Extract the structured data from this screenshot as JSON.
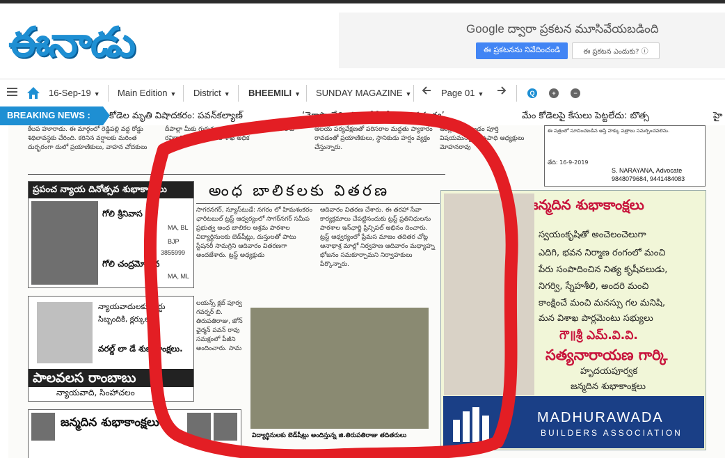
{
  "brand": {
    "logo_text": "ఈనాడు",
    "logo_color": "#1e8fd3"
  },
  "ad": {
    "by_google": "Google ద్వారా ప్రకటన మూసివేయబడింది",
    "report_button": "ఈ ప్రకటనను నివేదించండి",
    "why_button": "ఈ ప్రకటన ఎందుకు?",
    "info_icon": "ⓘ"
  },
  "nav": {
    "menu_icon": "hamburger-icon",
    "home_icon": "home-icon",
    "date": "16-Sep-19",
    "edition": "Main Edition",
    "district": "District",
    "area": "BHEEMILI",
    "magazine": "SUNDAY MAGAZINE",
    "page": "Page 01",
    "zoom_reset": "Q",
    "zoom_in": "+",
    "zoom_out": "−",
    "accent": "#1e8fd3"
  },
  "breaking": {
    "label": "BREAKING NEWS :",
    "items": [
      "కోడెల మృతి విషాదకరం: పవన్‌కల్యాణ్",
      "‘వైకాపా వేధింపులతోనే కోడెల ఆత్మహత్య’",
      "మేం కోడెలపై కేసులు పెట్టలేదు: బొత్స",
      "హై"
    ]
  },
  "paper": {
    "top_left_text": "కేలప హూరాడు. ఈ మార్గంలో రెడ్డిపల్లి వద్ద రోడ్డు శిథిలావస్థకు చేరింది. కరినిన వర్షాలకు మరింత దుర్భరంగా దులో ప్రయాణికులు, వాహన చోదకులు",
    "top_mid_text": "దీపాల్లా మీకు గురువులు ఉంటూ మనతో వెలు ఈ రోజు రవిదానిక్ రోడ్డు భవనాల శాఖ అధిక",
    "top_mid2_text": "ఆలయ పర్యవేక్షణతో పరిసరాల మద్దతు ప్యాకారం రావడంతో ప్రయాణికులు, స్థానికుడు హర్షం వ్యక్తం చేస్తున్నారు.",
    "top_right_text": "ఆంగ్లం నేర్పిస్తుండం పూర్తి విషయమన్నారు. ఉపాధి ఆధ్యక్షులు మోహనరావు",
    "notice_text": "ఈ పత్రంలో సూచించబడిన ఆస్తి హక్కు పత్రాలు సమర్పించవలెను.",
    "notice_sign": "S. NARAYANA, Advocate",
    "notice_phone": "9848079684, 9441484083",
    "notice_date": "తేది: 16-9-2019",
    "ad1_head": "ప్రపంచ న్యాయ దినోత్సవ శుభాకాంక్షలు",
    "ad1_name": "గోలి శ్రీనివాస",
    "ad1_deg": "MA, BL",
    "ad1_role": "BJP",
    "ad1_phone": "3855999",
    "ad1_name2": "గోలి చంద్రమోహన",
    "ad1_deg2": "MA, ML",
    "ad2_text": "న్యాయవాదులకు, కోర్టు సిబ్బందికి, క్లర్కులకు",
    "ad2_head": "వరల్డ్ లా డే శుభాకాంక్షలు.",
    "ad2_name": "పాలవలస రాంబాబు",
    "ad2_sub": "న్యాయవాది, సింహాచలం",
    "ad3_head": "జన్మదిన శుభాకాంక్షలు",
    "headline": "అంధ బాలికలకు వితరణ",
    "story_col1": "సాగరనగర్, న్యూస్‌టుడే: నగరం లో హిమశంకరం ఛారిటబుల్ ట్రస్ట్ ఆధ్వర్యంలో సాగర్‌నగర్ సమీప ప్రభుత్వ అంధ బాలికల ఆశ్రమ పాఠశాల విద్యార్థినులకు బెడ్‌షీట్లు, దుస్తులతో పాటు స్టేషనరీ సామగ్రిని ఆదివారం వితరణగా అందజేశారు. ట్రస్ట్ అధ్యక్షుడు",
    "story_col2": "ఆదివారం వితరణ చేశారు. ఈ తరహా సేవా కార్యక్రమాలు చేపట్టినందుకు ట్రస్ట్ ప్రతినిధులను పాఠశాల ఇన్‌ఛార్జి ప్రిన్సిపల్ అభినం దించారు. ట్రస్ట్ ఆధ్వర్యంలో ప్రేమస మాజం తదితర చోట్ల ఆనాథాశ్ర మాల్లో నిర్వహణ ఆదివారం మధ్యాహ్న భోజనం సమకూర్చామని నిర్వాహకులు పేర్కొన్నారు.",
    "story_col3": "లయన్స్ క్లబ్ పూర్వ గవర్నర్ బి. తిరుపతిరాజు, జోన్ ఛైర్మన్ పవన్ రావు సమక్షంలో పీజీని అందించారు. సామ",
    "photo_caption": "విద్యార్థినులకు బెడ్‌షీట్లు అందిస్తున్న జి.తిరుపతిరాజు తదితరులు",
    "bday_head": "జన్మదిన శుభాకాంక్షలు",
    "bday_lines": [
      "స్వయంకృషితో అంచెలంచెలుగా",
      "ఎదిగి, భవన నిర్మాణ రంగంలో మంచి",
      "పేరు సంపాదించిన నిత్య కృషీవలుడు,",
      "నిగర్వి, స్నేహశీలి, అందరి మంచి",
      "కాంక్షించే మంచి మనస్సు గల మనిషి,",
      "మన విశాఖ పార్లమెంటు సభ్యులు"
    ],
    "bday_title": "గౌ॥శ్రీ ఎమ్.వి.వి.",
    "bday_name": "సత్యనారాయణ గార్కి",
    "bday_wish1": "హృదయపూర్వక",
    "bday_wish2": "జన్మదిన శుభాకాంక్షలు",
    "builders_name": "MADHURAWADA",
    "builders_sub": "BUILDERS ASSOCIATION"
  }
}
